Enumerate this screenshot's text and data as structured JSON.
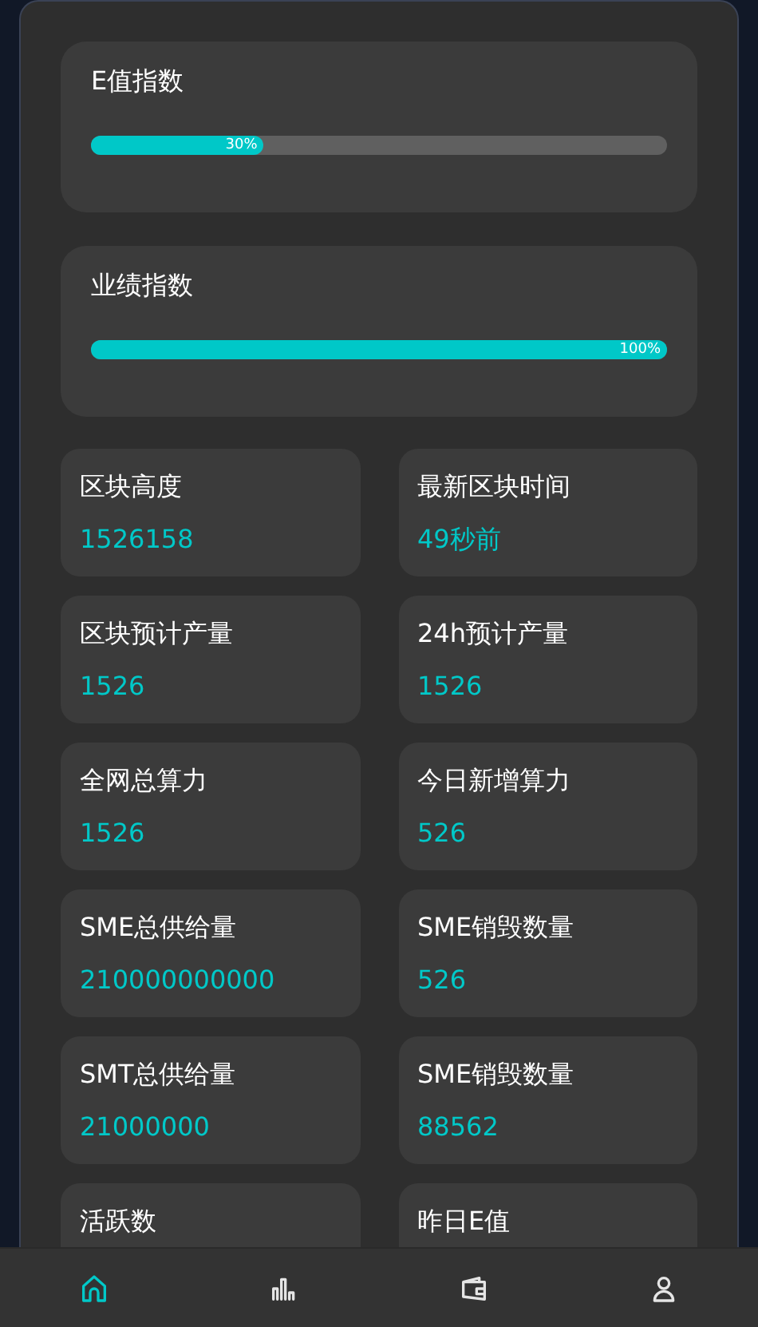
{
  "indices": [
    {
      "title": "E值指数",
      "level": 0.3,
      "reading": "30%"
    },
    {
      "title": "业绩指数",
      "level": 1,
      "reading": "100%"
    }
  ],
  "stats": [
    {
      "label": "区块高度",
      "value": "1526158"
    },
    {
      "label": "最新区块时间",
      "value": "49秒前"
    },
    {
      "label": "区块预计产量",
      "value": "1526"
    },
    {
      "label": "24h预计产量",
      "value": "1526"
    },
    {
      "label": "全网总算力",
      "value": "1526"
    },
    {
      "label": "今日新增算力",
      "value": "526"
    },
    {
      "label": "SME总供给量",
      "value": "210000000000"
    },
    {
      "label": "SME销毁数量",
      "value": "526"
    },
    {
      "label": "SMT总供给量",
      "value": "21000000"
    },
    {
      "label": "SME销毁数量",
      "value": "88562"
    },
    {
      "label": "活跃数"
    },
    {
      "label": "昨日E值"
    }
  ],
  "nav": [
    {
      "kind": "home",
      "selected": true
    },
    {
      "kind": "chart",
      "selected": false
    },
    {
      "kind": "wallet",
      "selected": false
    },
    {
      "kind": "user",
      "selected": false
    }
  ]
}
